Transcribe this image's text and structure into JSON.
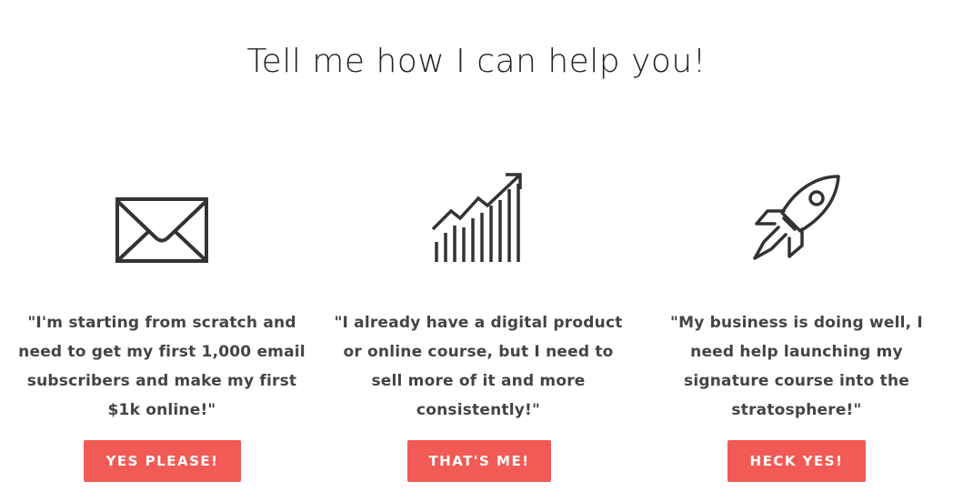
{
  "page": {
    "title": "Tell me how I can help you!"
  },
  "theme": {
    "accent": "#f25a55",
    "text": "#444444",
    "icon_stroke": "#333333"
  },
  "cards": [
    {
      "icon": "envelope-icon",
      "quote_lines": [
        "\"I'm starting from scratch and",
        "need to get my first 1,000 email",
        "subscribers and make my first",
        "$1k online!\""
      ],
      "button_label": "YES PLEASE!"
    },
    {
      "icon": "growth-chart-icon",
      "quote_lines": [
        "\"I already have a digital product",
        "or online course, but I need to",
        "sell more of it and more",
        "consistently!\""
      ],
      "button_label": "THAT'S ME!"
    },
    {
      "icon": "rocket-icon",
      "quote_lines": [
        "\"My business is doing well, I",
        "need help launching my",
        "signature course into the",
        "stratosphere!\""
      ],
      "button_label": "HECK YES!"
    }
  ]
}
